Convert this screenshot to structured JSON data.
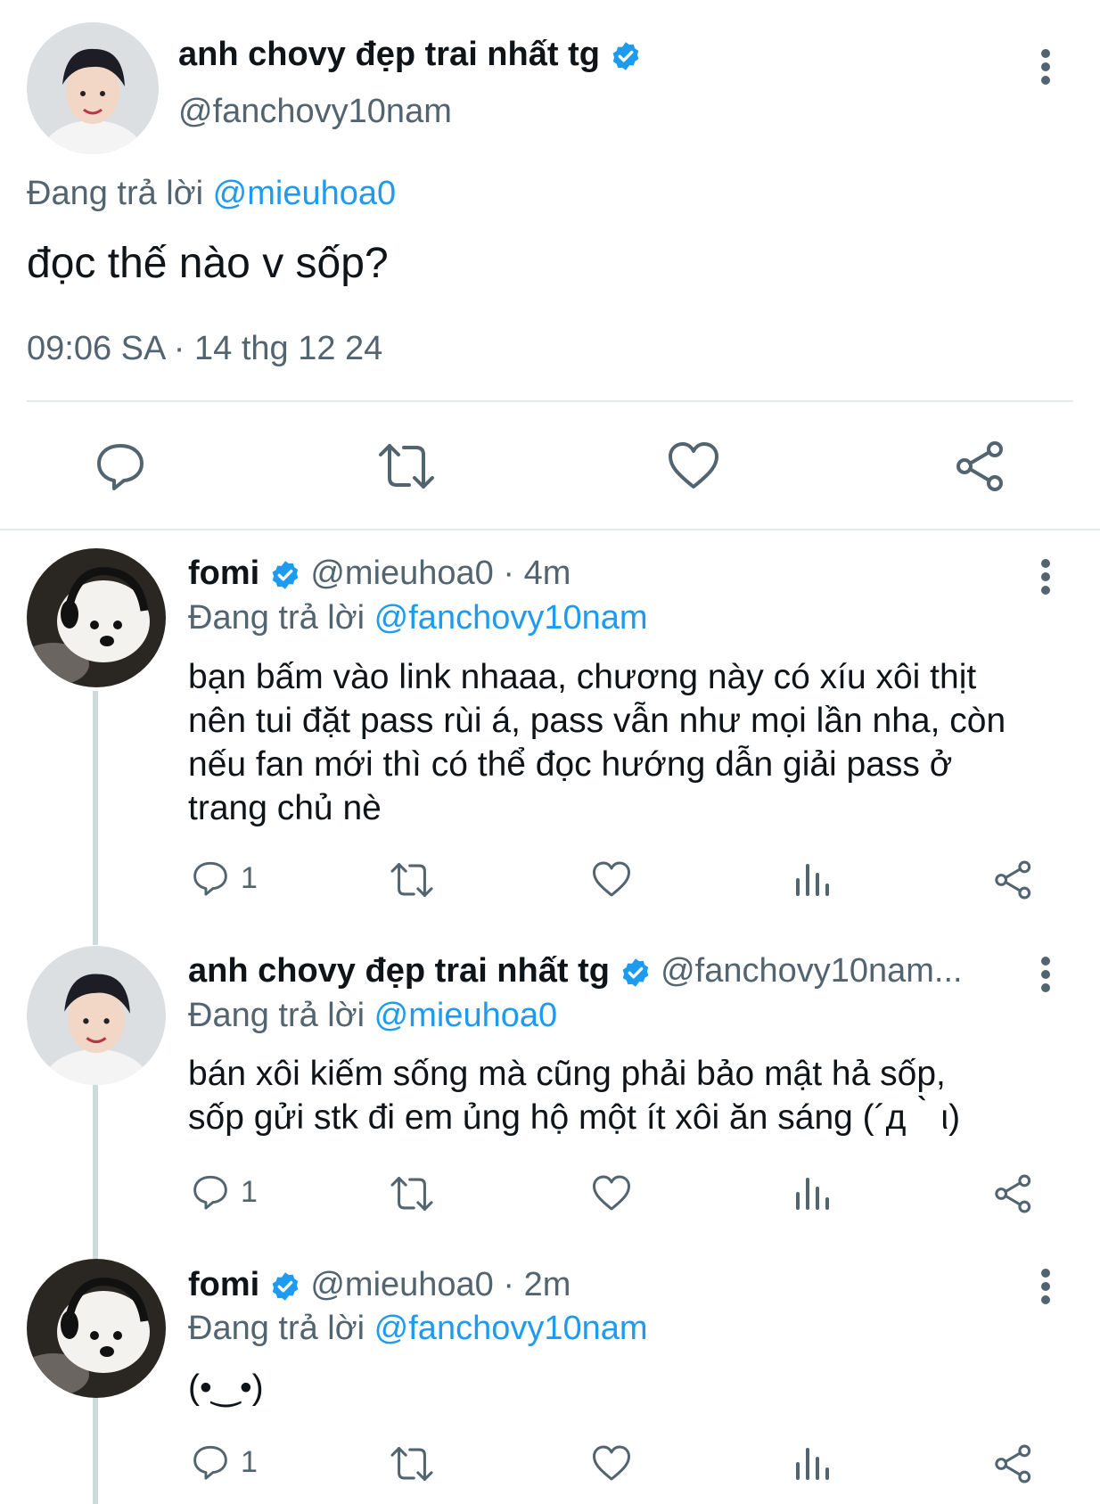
{
  "main_tweet": {
    "author_name": "anh chovy đẹp trai nhất tg",
    "handle": "@fanchovy10nam",
    "replying_prefix": "Đang trả lời",
    "replying_to": "@mieuhoa0",
    "text": "đọc thế nào v sốp?",
    "timestamp": "09:06 SA · 14 thg 12 24"
  },
  "replies": [
    {
      "author_name": "fomi",
      "handle_time": "@mieuhoa0 · 4m",
      "replying_prefix": "Đang trả lời",
      "replying_to": "@fanchovy10nam",
      "text_lines": [
        "bạn bấm vào link nhaaa, chương này có xíu xôi thịt",
        "nên tui đặt pass rùi á, pass vẫn như mọi lần nha, còn",
        "nếu fan mới thì có thể đọc hướng dẫn giải pass ở",
        "trang chủ nè"
      ],
      "reply_count": "1"
    },
    {
      "author_name": "anh chovy đẹp trai nhất tg",
      "handle_time": "@fanchovy10nam...",
      "replying_prefix": "Đang trả lời",
      "replying_to": "@mieuhoa0",
      "text_lines": [
        "bán xôi kiếm sống mà cũng phải bảo mật hả sốp,",
        "sốp gửi stk đi em ủng hộ một ít xôi ăn sáng (´д｀ι)"
      ],
      "reply_count": "1"
    },
    {
      "author_name": "fomi",
      "handle_time": "@mieuhoa0 · 2m",
      "replying_prefix": "Đang trả lời",
      "replying_to": "@fanchovy10nam",
      "text_lines": [
        "(•‿•)"
      ],
      "reply_count": "1"
    }
  ],
  "icons": {
    "reply": "reply-bubble-icon",
    "retweet": "retweet-icon",
    "like": "heart-icon",
    "views": "views-bar-icon",
    "share": "share-icon",
    "verified": "verified-badge-icon",
    "more": "more-vertical-icon"
  },
  "colors": {
    "accent": "#1d9bf0",
    "secondary_text": "#536471",
    "thread_line": "#cfd9de"
  }
}
